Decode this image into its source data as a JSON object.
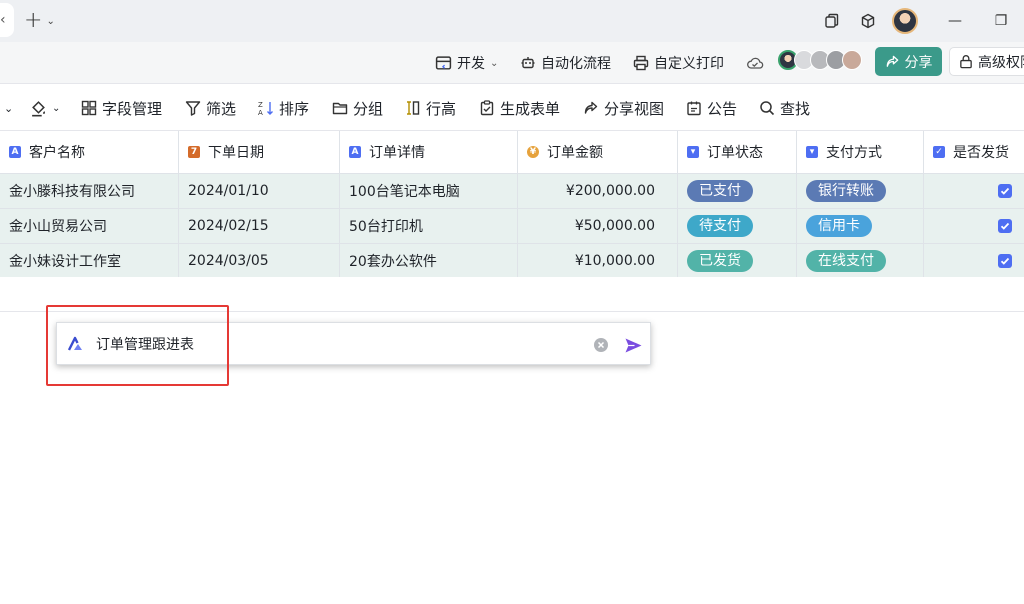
{
  "titlebar": {
    "window_controls": {
      "minimize": "—",
      "restore": "❐"
    }
  },
  "toolbar1": {
    "dev_label": "开发",
    "automation_label": "自动化流程",
    "custom_print_label": "自定义打印",
    "share_label": "分享",
    "permissions_label": "高级权限"
  },
  "toolbar2": {
    "field_manage": "字段管理",
    "filter": "筛选",
    "sort": "排序",
    "group": "分组",
    "row_height": "行高",
    "create_form": "生成表单",
    "share_view": "分享视图",
    "notice": "公告",
    "search": "查找"
  },
  "table": {
    "columns": [
      {
        "label": "客户名称",
        "type": "text"
      },
      {
        "label": "下单日期",
        "type": "date"
      },
      {
        "label": "订单详情",
        "type": "text"
      },
      {
        "label": "订单金额",
        "type": "currency"
      },
      {
        "label": "订单状态",
        "type": "select"
      },
      {
        "label": "支付方式",
        "type": "select"
      },
      {
        "label": "是否发货",
        "type": "checkbox"
      }
    ],
    "rows": [
      {
        "customer": "金小滕科技有限公司",
        "date": "2024/01/10",
        "detail": "100台笔记本电脑",
        "amount": "¥200,000.00",
        "status": "已支付",
        "payment": "银行转账",
        "shipped": true
      },
      {
        "customer": "金小山贸易公司",
        "date": "2024/02/15",
        "detail": "50台打印机",
        "amount": "¥50,000.00",
        "status": "待支付",
        "payment": "信用卡",
        "shipped": true
      },
      {
        "customer": "金小妹设计工作室",
        "date": "2024/03/05",
        "detail": "20套办公软件",
        "amount": "¥10,000.00",
        "status": "已发货",
        "payment": "在线支付",
        "shipped": true
      }
    ],
    "tag_colors": {
      "已支付": "#5b7ab4",
      "待支付": "#3ea8c9",
      "已发货": "#52b3a8",
      "银行转账": "#5b7ab4",
      "信用卡": "#4aa3dc",
      "在线支付": "#52b3a8"
    }
  },
  "prompt": {
    "value": "订单管理跟进表"
  },
  "colors": {
    "accent": "#4e6ef2",
    "share_button": "#3b9a8a",
    "highlight": "#e53935",
    "send_icon": "#7a4de0"
  }
}
